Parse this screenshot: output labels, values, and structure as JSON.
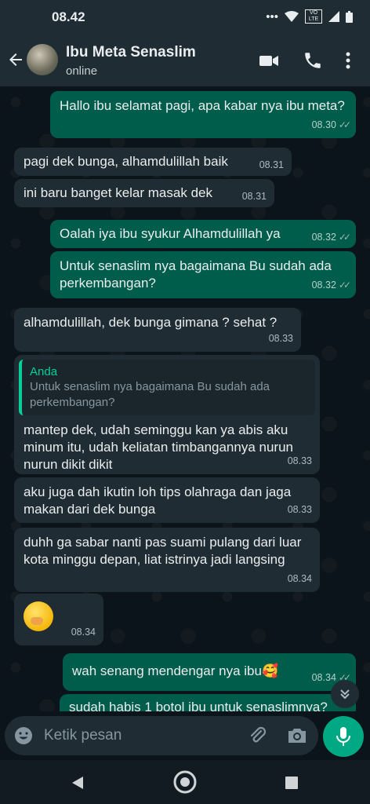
{
  "status": {
    "time": "08.42",
    "dots": "•••",
    "lte": "VO LTE"
  },
  "header": {
    "name": "Ibu Meta Senaslim",
    "status": "online"
  },
  "messages": [
    {
      "text": "Hallo ibu selamat pagi, apa kabar nya ibu meta?",
      "time": "08.30",
      "ticks": "✓✓"
    },
    {
      "text": "pagi dek bunga, alhamdulillah baik",
      "time": "08.31"
    },
    {
      "text": "ini baru banget kelar masak dek",
      "time": "08.31"
    },
    {
      "text": "Oalah iya ibu syukur Alhamdulillah ya",
      "time": "08.32",
      "ticks": "✓✓"
    },
    {
      "text": "Untuk senaslim nya bagaimana Bu sudah ada perkembangan?",
      "time": "08.32",
      "ticks": "✓✓"
    },
    {
      "text": "alhamdulillah, dek bunga gimana ? sehat ?",
      "time": "08.33"
    },
    {
      "quote_author": "Anda",
      "quote_text": "Untuk senaslim nya bagaimana Bu sudah ada perkembangan?",
      "text": "mantep dek, udah seminggu kan ya abis aku minum itu, udah keliatan timbangannya nurun nurun dikit dikit",
      "time": "08.33"
    },
    {
      "text": "aku juga dah ikutin loh tips olahraga dan jaga makan dari dek bunga",
      "time": "08.33"
    },
    {
      "text": "duhh ga sabar nanti pas suami pulang dari luar kota minggu depan, liat istrinya jadi langsing",
      "time": "08.34"
    },
    {
      "text": "",
      "time": "08.34"
    },
    {
      "text": "wah senang mendengar nya ibu🥰",
      "time": "08.34",
      "ticks": "✓✓"
    },
    {
      "text": "sudah habis 1 botol ibu untuk senaslimnya?"
    }
  ],
  "composer": {
    "placeholder": "Ketik pesan"
  },
  "icons": {
    "back": "arrow-left-icon",
    "video": "video-call-icon",
    "phone": "phone-icon",
    "menu": "more-vert-icon",
    "emoji": "emoji-icon",
    "attach": "paperclip-icon",
    "camera": "camera-icon",
    "mic": "mic-icon",
    "scroll": "chevron-double-down-icon"
  },
  "colors": {
    "outgoing": "#005c4b",
    "incoming": "#202c33",
    "accent": "#00a884",
    "header": "#1f2c33"
  }
}
